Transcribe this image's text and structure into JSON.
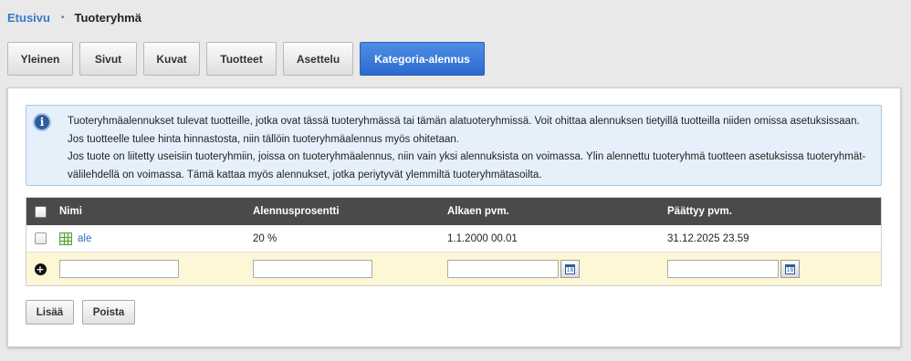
{
  "breadcrumb": {
    "home": "Etusivu",
    "separator": "•",
    "current": "Tuoteryhmä"
  },
  "tabs": [
    {
      "label": "Yleinen"
    },
    {
      "label": "Sivut"
    },
    {
      "label": "Kuvat"
    },
    {
      "label": "Tuotteet"
    },
    {
      "label": "Asettelu"
    },
    {
      "label": "Kategoria-alennus",
      "active": true
    }
  ],
  "info": {
    "icon": "info-icon",
    "lines": [
      "Tuoteryhmäalennukset tulevat tuotteille, jotka ovat tässä tuoteryhmässä tai tämän alatuoteryhmissä. Voit ohittaa alennuksen tietyillä tuotteilla niiden omissa asetuksissaan. Jos tuotteelle tulee hinta hinnastosta, niin tällöin tuoteryhmäalennus myös ohitetaan.",
      "Jos tuote on liitetty useisiin tuoteryhmiin, joissa on tuoteryhmäalennus, niin vain yksi alennuksista on voimassa. Ylin alennettu tuoteryhmä tuotteen asetuksissa tuoteryhmät-välilehdellä on voimassa. Tämä kattaa myös alennukset, jotka periytyvät ylemmiltä tuoteryhmätasoilta."
    ]
  },
  "table": {
    "columns": [
      "Nimi",
      "Alennusprosentti",
      "Alkaen pvm.",
      "Päättyy pvm."
    ],
    "rows": [
      {
        "name": "ale",
        "percent": "20 %",
        "start": "1.1.2000 00.01",
        "end": "31.12.2025 23.59"
      }
    ],
    "new_row": {
      "name": "",
      "percent": "",
      "start": "",
      "end": ""
    }
  },
  "buttons": {
    "add": "Lisää",
    "delete": "Poista"
  }
}
